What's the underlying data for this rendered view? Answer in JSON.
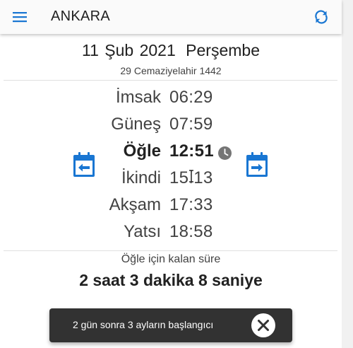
{
  "toolbar": {
    "menu_icon": "hamburger-menu-icon",
    "title": "ANKARA",
    "sync_icon": "sync-icon"
  },
  "date": {
    "gregorian": "11 Şub 2021",
    "weekday": "Perşembe",
    "hijri": "29 Cemaziyelahir 1442"
  },
  "prayer_times": [
    {
      "name": "İmsak",
      "time": "06:29",
      "current": false
    },
    {
      "name": "Güneş",
      "time": "07:59",
      "current": false
    },
    {
      "name": "Öğle",
      "time": "12:51",
      "current": true
    },
    {
      "name": "İkindi",
      "time": "15:13",
      "current": false
    },
    {
      "name": "Akşam",
      "time": "17:33",
      "current": false
    },
    {
      "name": "Yatsı",
      "time": "18:58",
      "current": false
    }
  ],
  "nav": {
    "prev_icon": "calendar-arrow-left-icon",
    "next_icon": "calendar-arrow-right-icon"
  },
  "current_indicator_icon": "clock-icon",
  "remaining": {
    "label": "Öğle için kalan süre",
    "value": "2 saat 3 dakika 8 saniye"
  },
  "snackbar": {
    "message": "2 gün sonra 3 ayların başlangıcı",
    "close_icon": "close-icon"
  },
  "colors": {
    "accent": "#1976d2",
    "toolbar_bg": "#fafafa",
    "snackbar_bg": "#323232",
    "icon_gray": "#757575"
  }
}
